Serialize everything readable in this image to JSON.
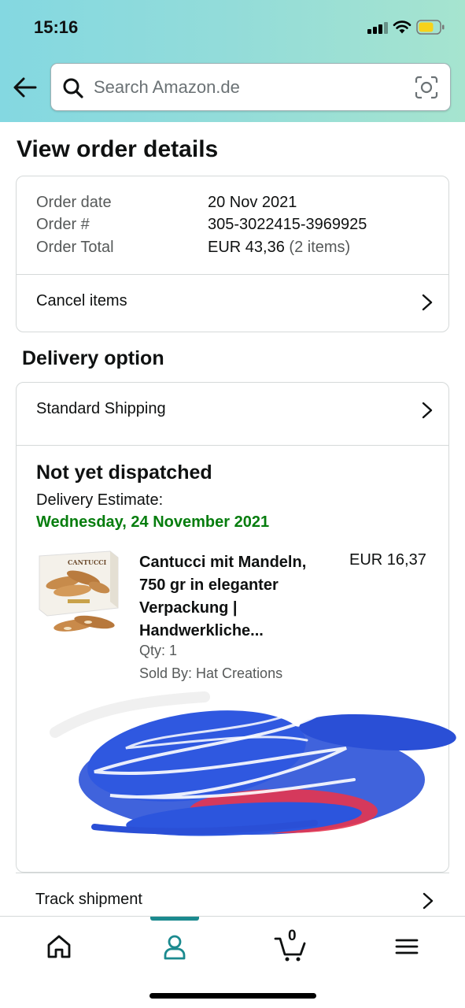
{
  "status_bar": {
    "time": "15:16"
  },
  "search": {
    "placeholder": "Search Amazon.de"
  },
  "page": {
    "title": "View order details"
  },
  "order_info": {
    "rows": [
      {
        "label": "Order date",
        "value": "20 Nov 2021",
        "sub": ""
      },
      {
        "label": "Order #",
        "value": "305-3022415-3969925",
        "sub": ""
      },
      {
        "label": "Order Total",
        "value": "EUR 43,36",
        "sub": "(2 items)"
      }
    ],
    "cancel_label": "Cancel items"
  },
  "delivery": {
    "heading": "Delivery option",
    "shipping_label": "Standard Shipping",
    "status": "Not yet dispatched",
    "estimate_label": "Delivery Estimate:",
    "estimate_date": "Wednesday, 24 November 2021",
    "estimate_color": "#067d0e"
  },
  "items": [
    {
      "title": "Cantucci mit Mandeln, 750 gr in eleganter Verpackung | Handwerkliche...",
      "price": "EUR 16,37",
      "qty": "Qty: 1",
      "seller": "Sold By: Hat Creations",
      "image_icon": "cantucci-box-image",
      "brand_text": "CANTUCCI"
    }
  ],
  "track_label": "Track shipment",
  "tabbar": {
    "tabs": [
      "home-icon",
      "profile-icon",
      "cart-icon",
      "menu-icon"
    ],
    "active": "profile-icon",
    "cart_count": "0",
    "accent": "#1b8a8f"
  }
}
